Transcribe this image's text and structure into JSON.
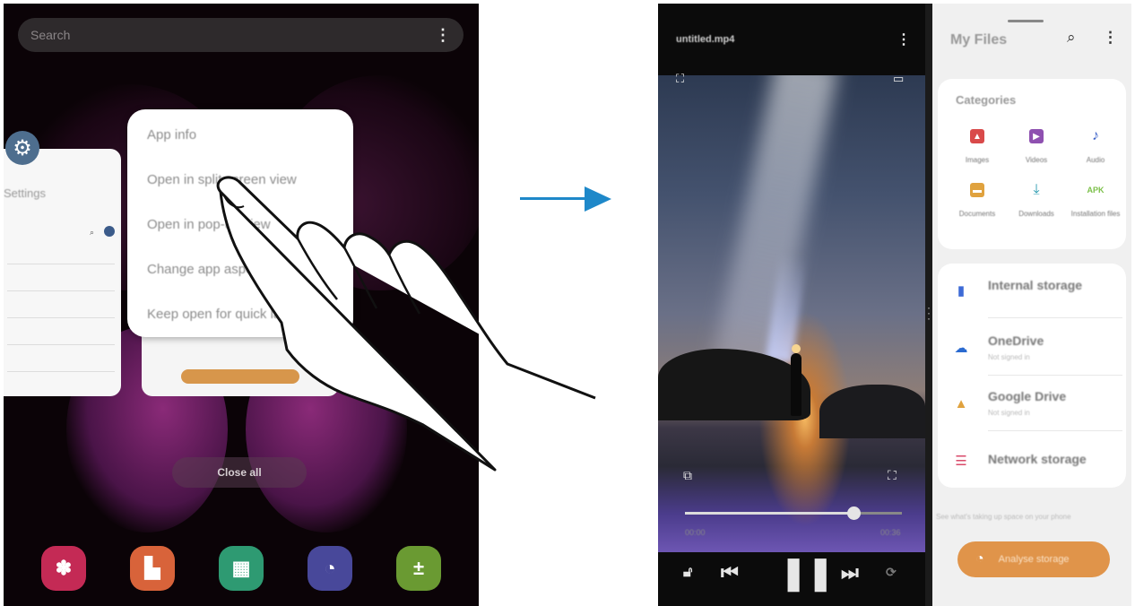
{
  "left": {
    "search_placeholder": "Search",
    "settings_label": "Settings",
    "menu_items": [
      "App info",
      "Open in split screen view",
      "Open in pop-up view",
      "Change app aspect ratio",
      "Keep open for quick launch"
    ],
    "close_all_label": "Close all",
    "dock_apps": [
      {
        "name": "galaxy-store-icon",
        "color": "#c42a55",
        "glyph": "✽"
      },
      {
        "name": "notes-icon",
        "color": "#d8633a",
        "glyph": "▙"
      },
      {
        "name": "calendar-icon",
        "color": "#2e9a72",
        "glyph": "▦"
      },
      {
        "name": "clock-icon",
        "color": "#48489a",
        "glyph": "◔"
      },
      {
        "name": "calculator-icon",
        "color": "#6a9a32",
        "glyph": "±"
      }
    ]
  },
  "right": {
    "video": {
      "title": "untitled.mp4",
      "time_elapsed": "00:00",
      "time_total": "00:36",
      "progress": 0.78
    },
    "files": {
      "title": "My Files",
      "categories_title": "Categories",
      "categories": [
        {
          "label": "Images",
          "icon": "image-icon",
          "color": "#d94a4a",
          "glyph": "▲"
        },
        {
          "label": "Videos",
          "icon": "video-icon",
          "color": "#8e50b0",
          "glyph": "▶"
        },
        {
          "label": "Audio",
          "icon": "audio-icon",
          "color": "#3d62c8",
          "glyph": "♪"
        },
        {
          "label": "Documents",
          "icon": "document-icon",
          "color": "#e0a23e",
          "glyph": "▬"
        },
        {
          "label": "Downloads",
          "icon": "download-icon",
          "color": "#2a9bb0",
          "glyph": "⤓"
        },
        {
          "label": "Installation files",
          "icon": "apk-icon",
          "color": "#7cc04a",
          "glyph": "APK"
        }
      ],
      "storages": [
        {
          "name": "Internal storage",
          "sub": "",
          "icon": "phone-icon",
          "color": "#3d6ad6",
          "glyph": "▮"
        },
        {
          "name": "OneDrive",
          "sub": "Not signed in",
          "icon": "onedrive-icon",
          "color": "#2a6ad0",
          "glyph": "☁"
        },
        {
          "name": "Google Drive",
          "sub": "Not signed in",
          "icon": "google-drive-icon",
          "color": "#e0a23e",
          "glyph": "▲"
        },
        {
          "name": "Network storage",
          "sub": "",
          "icon": "network-storage-icon",
          "color": "#d94a6a",
          "glyph": "☰"
        }
      ],
      "space_text": "See what's taking up space on your phone",
      "analyse_label": "Analyse storage"
    }
  }
}
